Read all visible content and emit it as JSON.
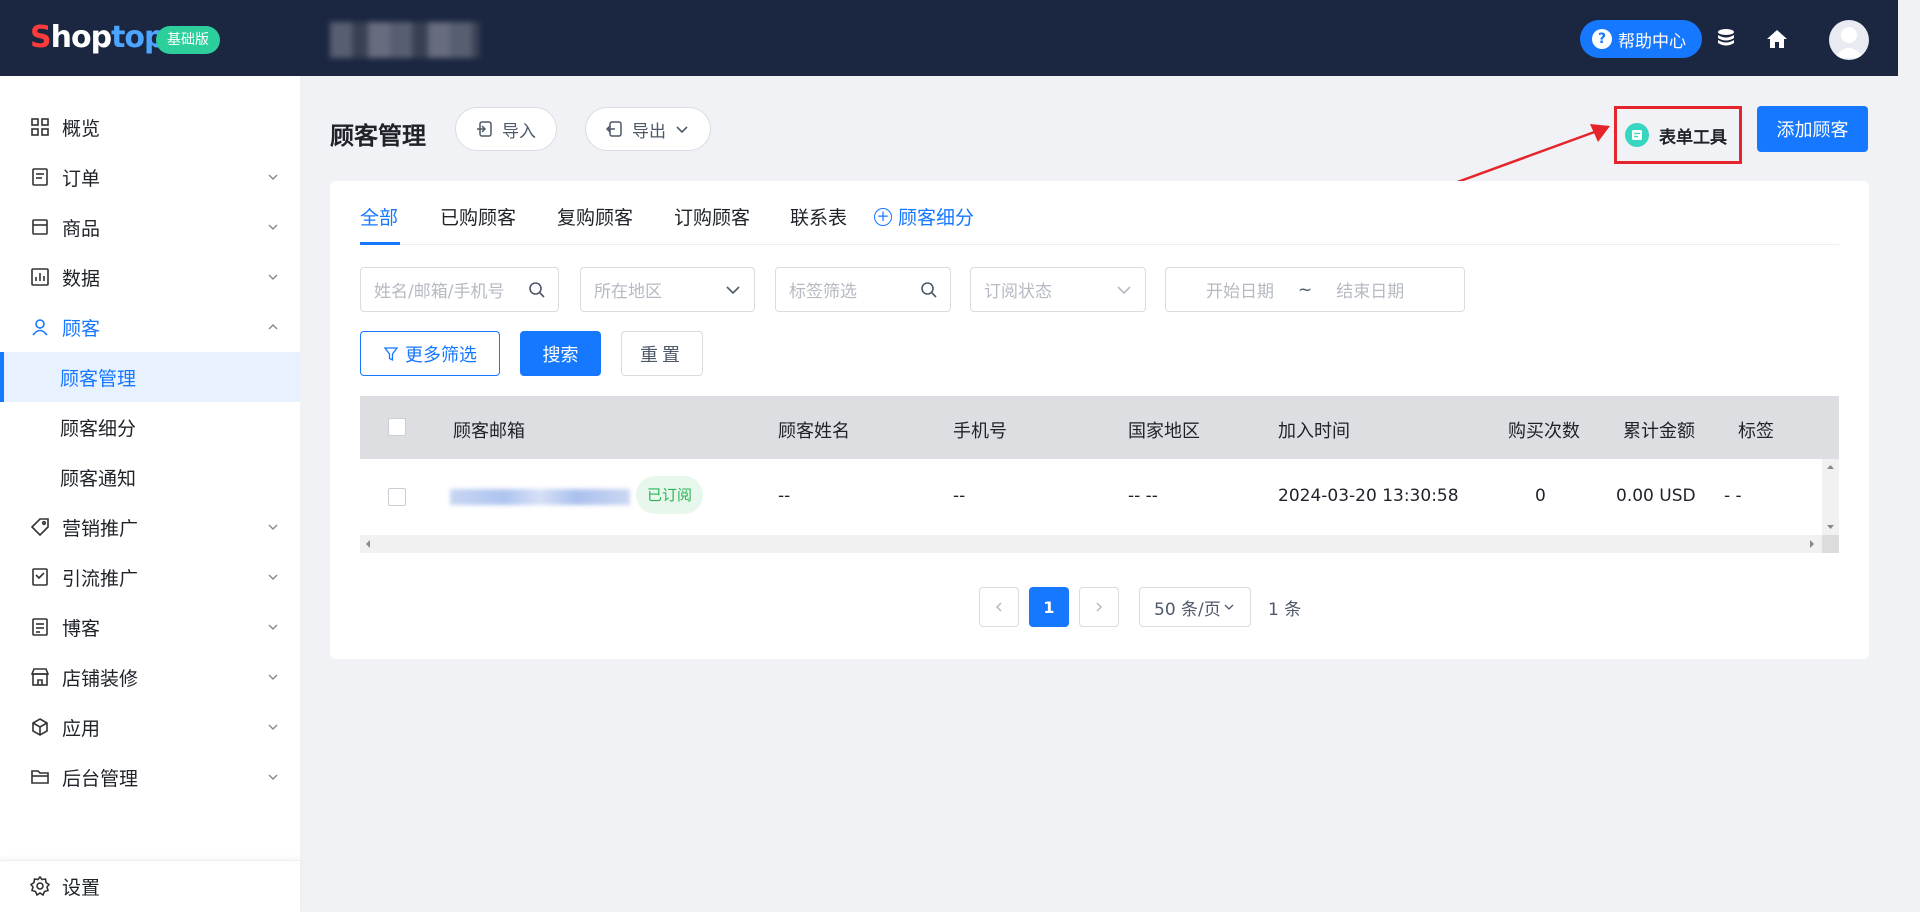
{
  "brand": {
    "part1": "S",
    "part2": "hop",
    "part3": "top",
    "plan": "基础版"
  },
  "topbar": {
    "help_label": "帮助中心"
  },
  "sidebar": {
    "items": [
      {
        "label": "概览"
      },
      {
        "label": "订单"
      },
      {
        "label": "商品"
      },
      {
        "label": "数据"
      },
      {
        "label": "顾客"
      },
      {
        "label": "营销推广"
      },
      {
        "label": "引流推广"
      },
      {
        "label": "博客"
      },
      {
        "label": "店铺装修"
      },
      {
        "label": "应用"
      },
      {
        "label": "后台管理"
      }
    ],
    "customer_sub": [
      {
        "label": "顾客管理"
      },
      {
        "label": "顾客细分"
      },
      {
        "label": "顾客通知"
      }
    ],
    "settings_label": "设置"
  },
  "header": {
    "title": "顾客管理",
    "import_label": "导入",
    "export_label": "导出",
    "form_tool_label": "表单工具",
    "add_customer_label": "添加顾客"
  },
  "tabs": [
    {
      "label": "全部"
    },
    {
      "label": "已购顾客"
    },
    {
      "label": "复购顾客"
    },
    {
      "label": "订购顾客"
    },
    {
      "label": "联系表"
    },
    {
      "label": "顾客细分"
    }
  ],
  "filters": {
    "search_placeholder": "姓名/邮箱/手机号",
    "region_placeholder": "所在地区",
    "tag_placeholder": "标签筛选",
    "subscribe_placeholder": "订阅状态",
    "start_date_placeholder": "开始日期",
    "date_separator": "~",
    "end_date_placeholder": "结束日期",
    "more_filters_label": "更多筛选",
    "search_label": "搜索",
    "reset_label": "重置"
  },
  "table": {
    "columns": [
      "顾客邮箱",
      "顾客姓名",
      "手机号",
      "国家地区",
      "加入时间",
      "购买次数",
      "累计金额",
      "标签"
    ],
    "rows": [
      {
        "subscribed": "已订阅",
        "name": "--",
        "phone": "--",
        "country": "-- --",
        "joined": "2024-03-20 13:30:58",
        "purchases": "0",
        "total": "0.00 USD",
        "tags": "- -"
      }
    ]
  },
  "pagination": {
    "total": "1 条",
    "current_page": "1",
    "page_size": "50 条/页"
  },
  "colors": {
    "primary": "#1677ff",
    "topbar": "#1b2640",
    "highlight": "#e5242b",
    "success": "#29b556"
  }
}
